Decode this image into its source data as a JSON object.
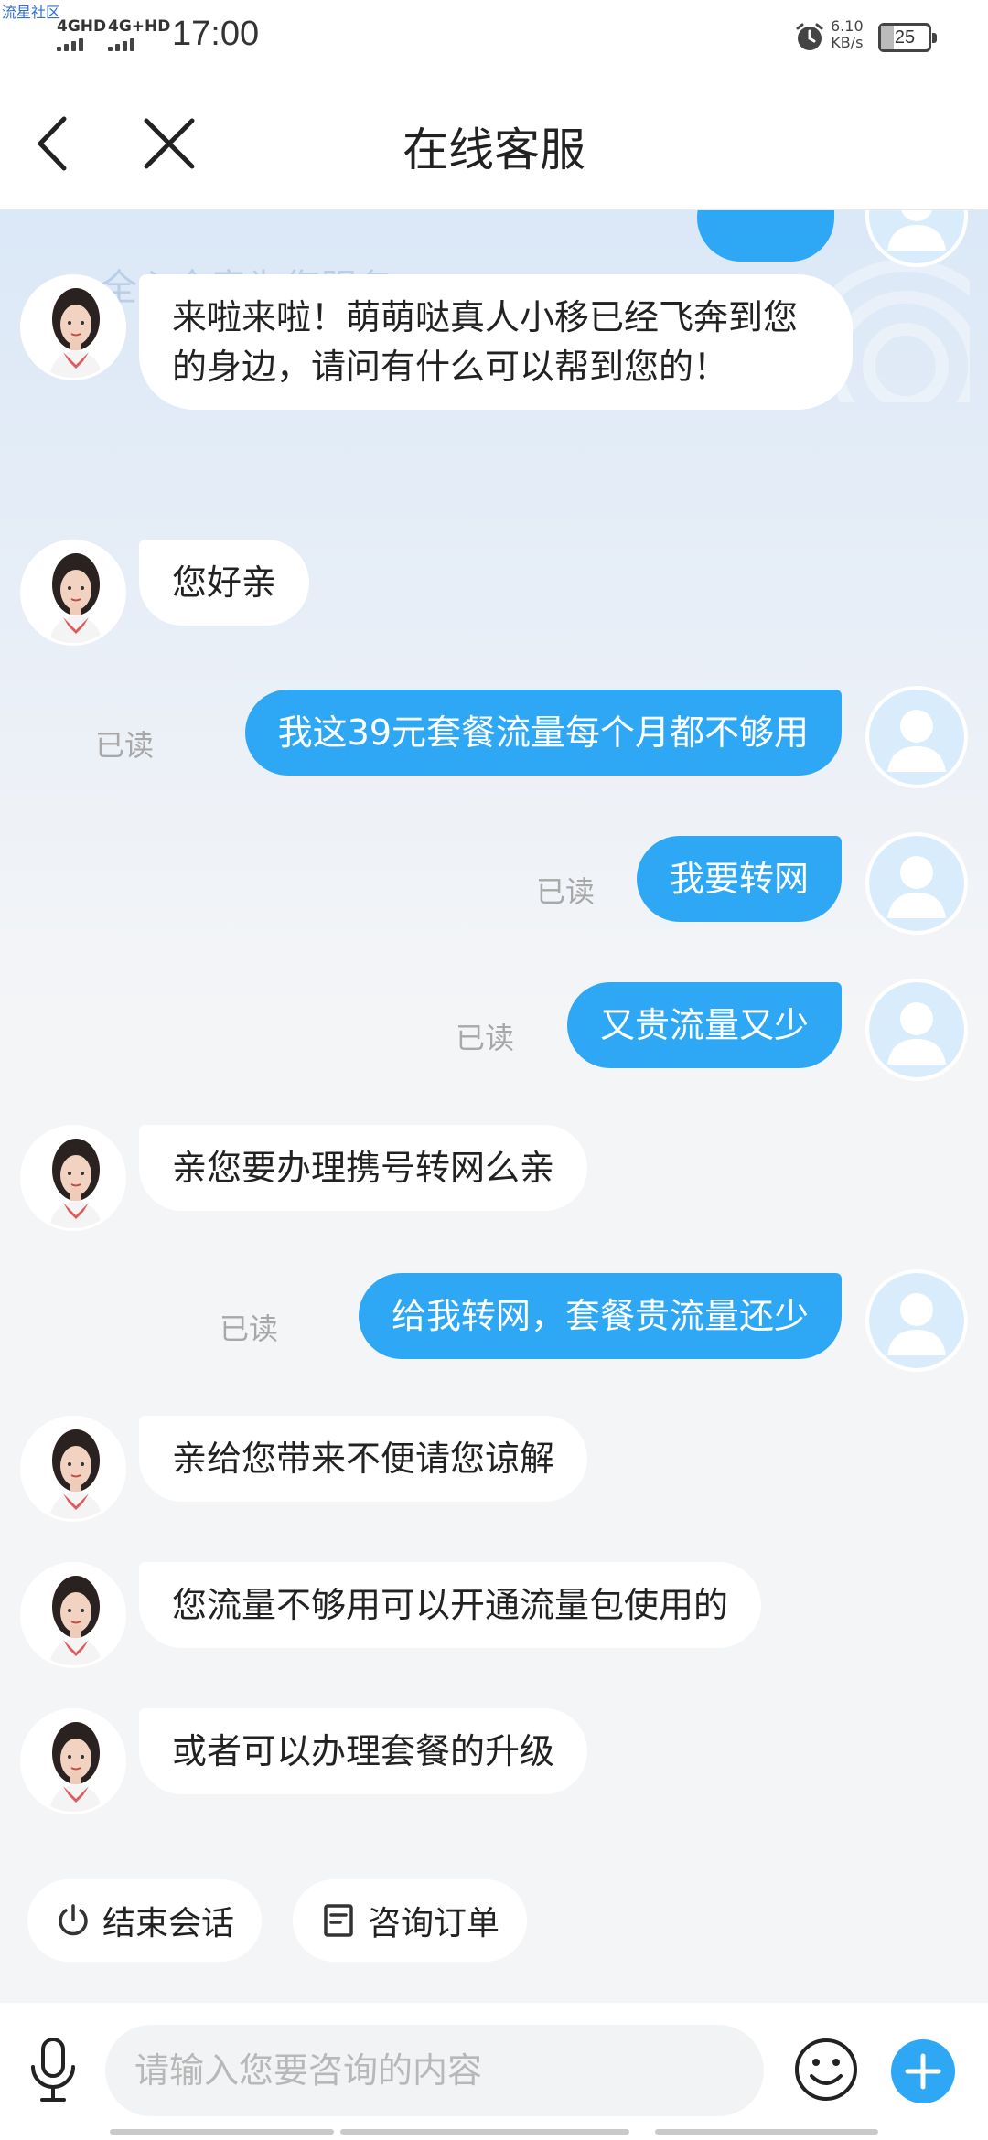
{
  "status_bar": {
    "watermark": "流星社区",
    "network_1": "4GHD",
    "network_2": "4G+HD",
    "time": "17:00",
    "speed_value": "6.10",
    "speed_unit": "KB/s",
    "battery": "25"
  },
  "header": {
    "title": "在线客服",
    "back_icon": "chevron-left-icon",
    "close_icon": "close-icon"
  },
  "banner_text": "全心全意为您服务",
  "messages": [
    {
      "from": "agent",
      "text": "来啦来啦！萌萌哒真人小移已经飞奔到您的身边，请问有什么可以帮到您的！"
    },
    {
      "from": "agent",
      "text": "您好亲"
    },
    {
      "from": "user",
      "text": "我这39元套餐流量每个月都不够用",
      "status": "已读"
    },
    {
      "from": "user",
      "text": "我要转网",
      "status": "已读"
    },
    {
      "from": "user",
      "text": "又贵流量又少",
      "status": "已读"
    },
    {
      "from": "agent",
      "text": "亲您要办理携号转网么亲"
    },
    {
      "from": "user",
      "text": "给我转网，套餐贵流量还少",
      "status": "已读"
    },
    {
      "from": "agent",
      "text": "亲给您带来不便请您谅解"
    },
    {
      "from": "agent",
      "text": "您流量不够用可以开通流量包使用的"
    },
    {
      "from": "agent",
      "text": "或者可以办理套餐的升级"
    }
  ],
  "quick_actions": {
    "end_session": "结束会话",
    "order_inquiry": "咨询订单"
  },
  "input": {
    "placeholder": "请输入您要咨询的内容",
    "value": ""
  },
  "colors": {
    "accent": "#2ea8f5",
    "agent_bubble": "#ffffff",
    "read_text": "#a8a8a8"
  }
}
